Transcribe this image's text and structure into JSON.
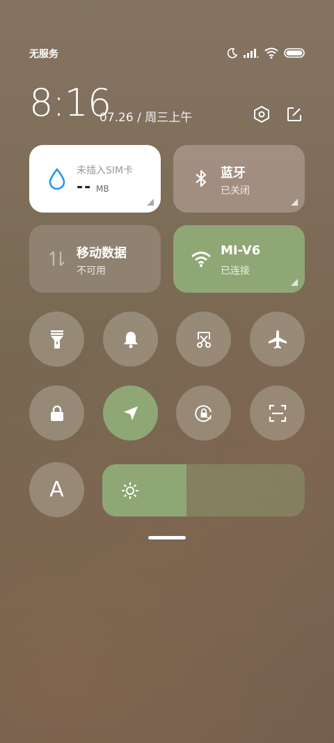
{
  "status_bar": {
    "carrier": "无服务"
  },
  "header": {
    "time": "8:16",
    "date": "07.26 / 周三上午"
  },
  "tiles": {
    "sim": {
      "title": "未插入SIM卡",
      "value": "--",
      "unit": "MB"
    },
    "bluetooth": {
      "title": "蓝牙",
      "status": "已关闭"
    },
    "mobile_data": {
      "title": "移动数据",
      "status": "不可用"
    },
    "wifi": {
      "title": "MI-V6",
      "status": "已连接"
    }
  },
  "toggles": [
    {
      "name": "flashlight",
      "icon": "flashlight-icon",
      "active": false
    },
    {
      "name": "silent",
      "icon": "bell-icon",
      "active": false
    },
    {
      "name": "screenshot",
      "icon": "scissors-screenshot-icon",
      "active": false
    },
    {
      "name": "airplane",
      "icon": "airplane-icon",
      "active": false
    },
    {
      "name": "lock-screen",
      "icon": "lock-icon",
      "active": false
    },
    {
      "name": "location",
      "icon": "location-arrow-icon",
      "active": true
    },
    {
      "name": "auto-rotate",
      "icon": "rotation-lock-icon",
      "active": false
    },
    {
      "name": "scanner",
      "icon": "scan-icon",
      "active": false
    },
    {
      "name": "auto-brightness",
      "icon": "letter-a-icon",
      "label": "A",
      "active": false
    }
  ],
  "brightness": {
    "level_fraction": 0.415
  },
  "colors": {
    "accent": "#8fa775",
    "tile_white": "#ffffff"
  }
}
